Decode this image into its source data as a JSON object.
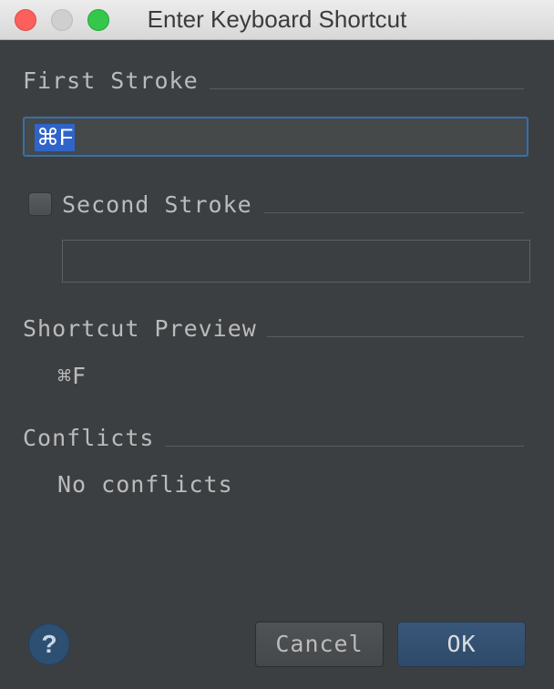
{
  "window": {
    "title": "Enter Keyboard Shortcut"
  },
  "first_stroke": {
    "label": "First Stroke",
    "value": "⌘F"
  },
  "second_stroke": {
    "label": "Second Stroke",
    "checked": false,
    "value": ""
  },
  "shortcut_preview": {
    "label": "Shortcut Preview",
    "value": "⌘F"
  },
  "conflicts": {
    "label": "Conflicts",
    "value": "No conflicts"
  },
  "buttons": {
    "help": "?",
    "cancel": "Cancel",
    "ok": "OK"
  },
  "colors": {
    "background": "#3c3f41",
    "accent": "#2f65ca",
    "ok_button": "#2f4a69"
  }
}
